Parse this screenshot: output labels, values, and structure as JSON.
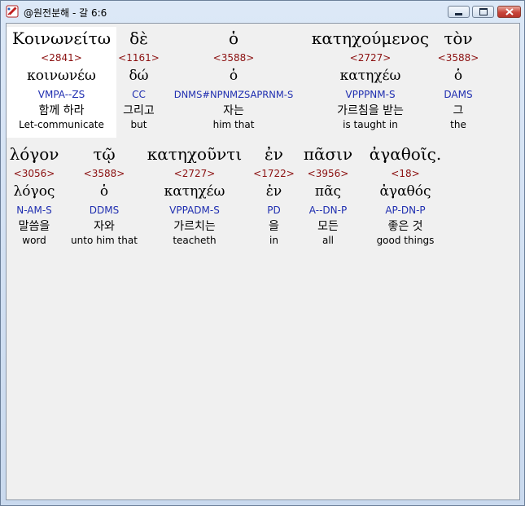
{
  "window": {
    "title": "@원전분해 - 갈 6:6",
    "minimize_label": "minimize",
    "maximize_label": "maximize",
    "close_label": "close"
  },
  "rows": [
    {
      "words": [
        {
          "greek": "Κοινωνείτω",
          "strong": "<2841>",
          "lemma": "κοινωνέω",
          "morph": "VMPA--ZS",
          "korean": "함께 하라",
          "english": "Let-communicate",
          "selected": true
        },
        {
          "greek": "δὲ",
          "strong": "<1161>",
          "lemma": "δώ",
          "morph": "CC",
          "korean": "그리고",
          "english": "but"
        },
        {
          "greek": "ὁ",
          "strong": "<3588>",
          "lemma": "ὁ",
          "morph": "DNMS#NPNMZSAPRNM-S",
          "korean": "자는",
          "english": "him that"
        },
        {
          "greek": "κατηχούμενος",
          "strong": "<2727>",
          "lemma": "κατηχέω",
          "morph": "VPPPNM-S",
          "korean": "가르침을 받는",
          "english": "is taught in"
        },
        {
          "greek": "τὸν",
          "strong": "<3588>",
          "lemma": "ὁ",
          "morph": "DAMS",
          "korean": "그",
          "english": "the"
        }
      ]
    },
    {
      "words": [
        {
          "greek": "λόγον",
          "strong": "<3056>",
          "lemma": "λόγος",
          "morph": "N-AM-S",
          "korean": "말씀을",
          "english": "word"
        },
        {
          "greek": "τῷ",
          "strong": "<3588>",
          "lemma": "ὁ",
          "morph": "DDMS",
          "korean": "자와",
          "english": "unto him that"
        },
        {
          "greek": "κατηχοῦντι",
          "strong": "<2727>",
          "lemma": "κατηχέω",
          "morph": "VPPADM-S",
          "korean": "가르치는",
          "english": "teacheth"
        },
        {
          "greek": "ἐν",
          "strong": "<1722>",
          "lemma": "ἐν",
          "morph": "PD",
          "korean": "을",
          "english": "in"
        },
        {
          "greek": "πᾶσιν",
          "strong": "<3956>",
          "lemma": "πᾶς",
          "morph": "A--DN-P",
          "korean": "모든",
          "english": "all"
        },
        {
          "greek": "ἀγαθοῖς.",
          "strong": "<18>",
          "lemma": "ἀγαθός",
          "morph": "AP-DN-P",
          "korean": "좋은 것",
          "english": "good things"
        }
      ]
    }
  ]
}
